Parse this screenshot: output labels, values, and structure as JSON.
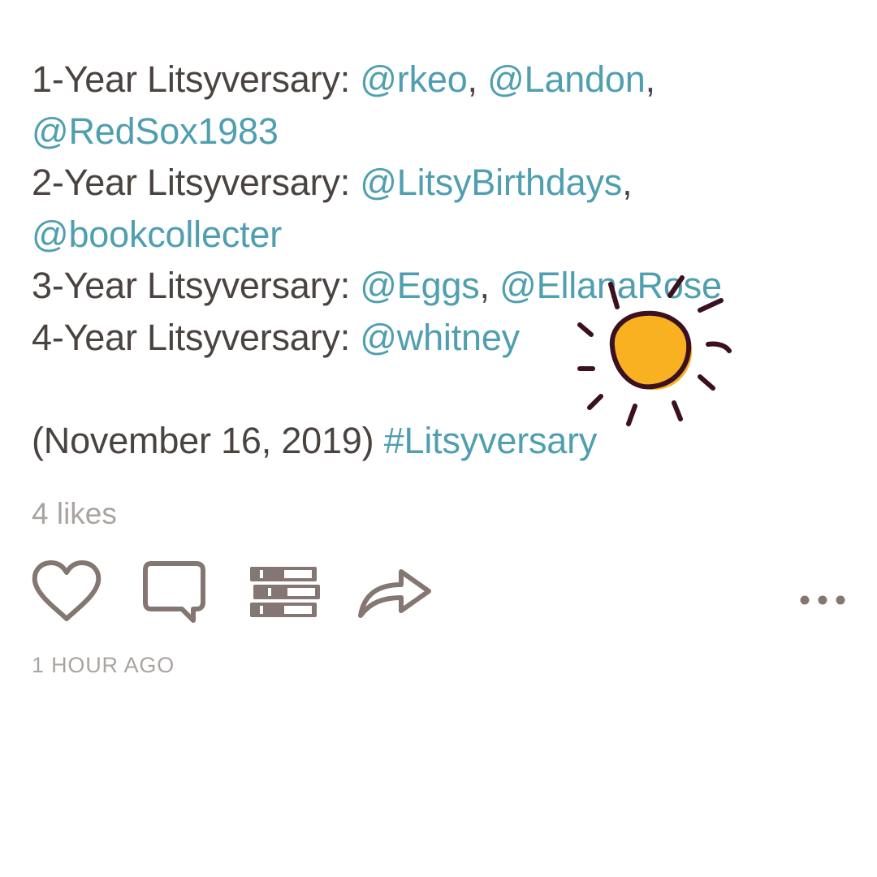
{
  "post": {
    "lines": [
      {
        "label": "1-Year Litsyversary: ",
        "mentions_line1": [
          "@rkeo",
          "@Landon"
        ],
        "mentions_line2": [
          "@RedSox1983"
        ]
      },
      {
        "label": "2-Year Litsyversary: ",
        "mentions_line1": [
          "@LitsyBirthdays"
        ],
        "mentions_line2": [
          "@bookcollecter"
        ]
      },
      {
        "label": "3-Year Litsyversary: ",
        "mentions_line1": [
          "@Eggs",
          "@EllanaRose"
        ]
      },
      {
        "label": "4-Year Litsyversary: ",
        "mentions_line1": [
          "@whitney"
        ]
      }
    ],
    "date_text": "(November 16, 2019) ",
    "hashtag": "#Litsyversary",
    "separator": ", "
  },
  "likes": "4 likes",
  "actions": {
    "like_icon": "heart-icon",
    "comment_icon": "comment-bubble-icon",
    "stack_icon": "book-stack-icon",
    "share_icon": "share-arrow-icon",
    "more_icon": "more-dots-icon"
  },
  "timestamp": "1 HOUR AGO",
  "colors": {
    "text": "#4a4340",
    "link": "#4f9fb0",
    "muted": "#a9a4a1",
    "icon": "#847772",
    "sun_fill": "#f9b122",
    "sun_stroke": "#3b1020"
  }
}
